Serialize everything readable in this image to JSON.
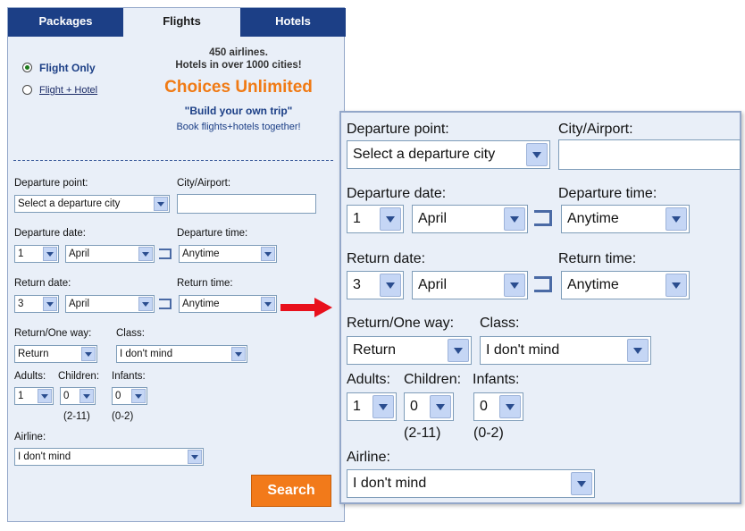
{
  "tabs": [
    {
      "label": "Packages"
    },
    {
      "label": "Flights"
    },
    {
      "label": "Hotels"
    }
  ],
  "options": {
    "flight_only": "Flight Only",
    "flight_hotel": "Flight + Hotel"
  },
  "promo": {
    "line1": "450 airlines.",
    "line2": "Hotels in over 1000 cities!",
    "headline": "Choices Unlimited",
    "tagline": "\"Build your own trip\"",
    "link": "Book flights+hotels together!"
  },
  "form": {
    "departure_point_label": "Departure point:",
    "departure_point_value": "Select a departure city",
    "city_airport_label": "City/Airport:",
    "city_airport_value": "",
    "departure_date_label": "Departure date:",
    "departure_day": "1",
    "departure_month": "April",
    "departure_time_label": "Departure time:",
    "departure_time": "Anytime",
    "return_date_label": "Return date:",
    "return_day": "3",
    "return_month": "April",
    "return_time_label": "Return time:",
    "return_time": "Anytime",
    "return_oneway_label": "Return/One way:",
    "return_oneway_value": "Return",
    "class_label": "Class:",
    "class_value": "I don't mind",
    "adults_label": "Adults:",
    "adults_value": "1",
    "children_label": "Children:",
    "children_value": "0",
    "children_hint": "(2-11)",
    "infants_label": "Infants:",
    "infants_value": "0",
    "infants_hint": "(0-2)",
    "airline_label": "Airline:",
    "airline_value": "I don't mind",
    "search_label": "Search"
  },
  "colors": {
    "tab_dark": "#1c3f86",
    "panel_bg": "#e9eff8",
    "accent_orange": "#f07a14",
    "arrow_red": "#e8101c"
  }
}
